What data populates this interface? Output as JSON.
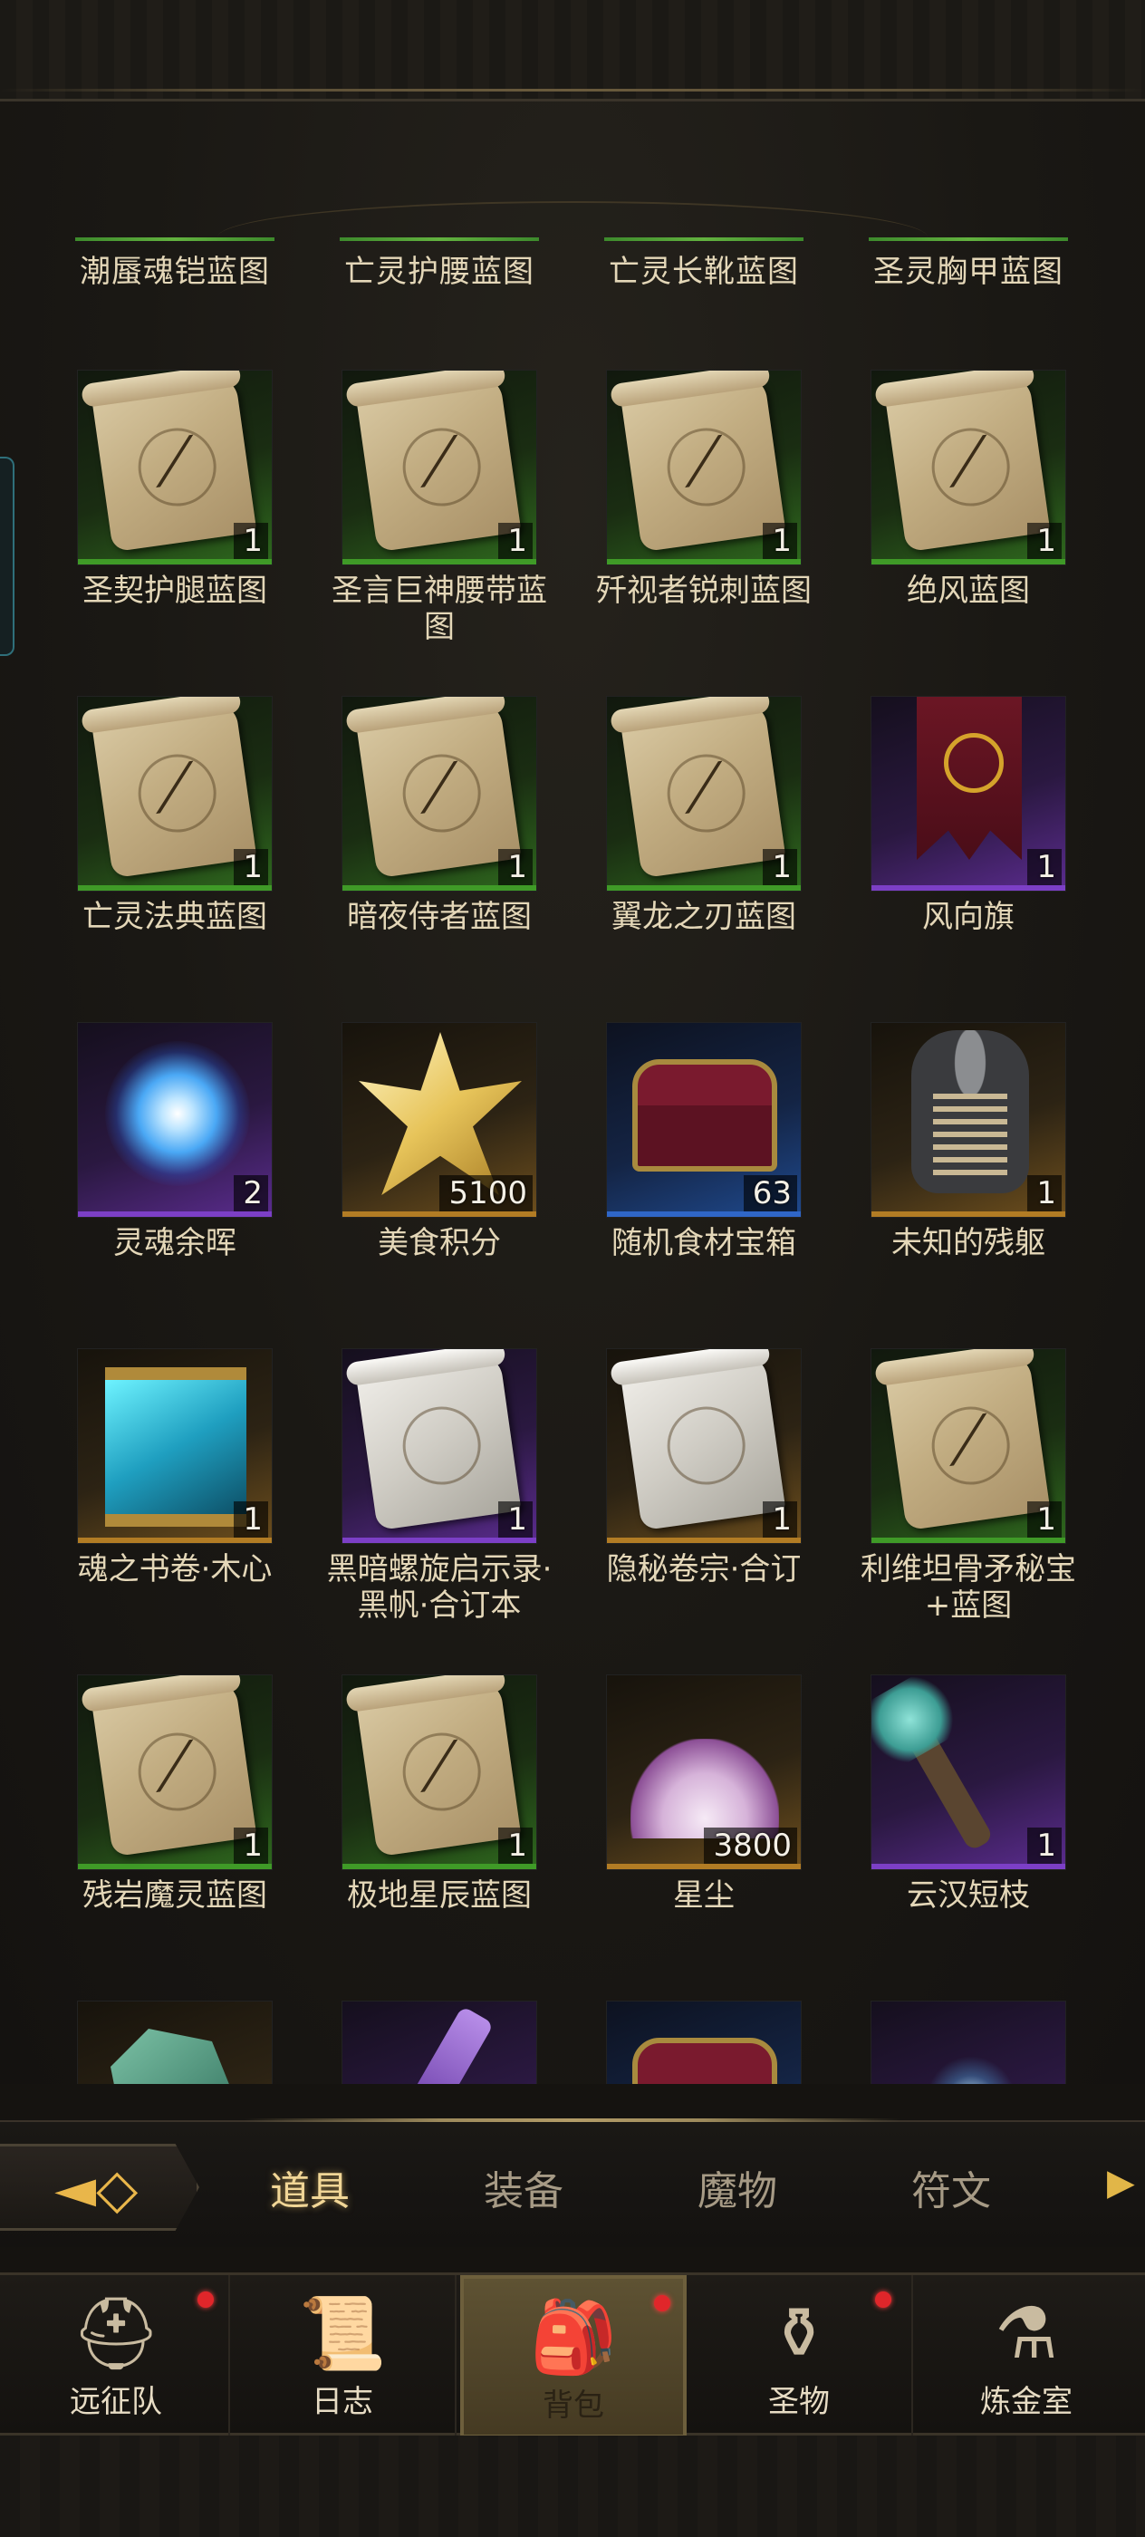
{
  "headers": [
    "潮蜃魂铠蓝图",
    "亡灵护腰蓝图",
    "亡灵长靴蓝图",
    "圣灵胸甲蓝图"
  ],
  "items": [
    {
      "name": "圣契护腿蓝图",
      "count": "1",
      "rarity": "green",
      "icon": "blueprint-scroll-icon"
    },
    {
      "name": "圣言巨神腰带蓝图",
      "count": "1",
      "rarity": "green",
      "icon": "blueprint-scroll-icon"
    },
    {
      "name": "歼视者锐刺蓝图",
      "count": "1",
      "rarity": "green",
      "icon": "blueprint-scroll-icon"
    },
    {
      "name": "绝风蓝图",
      "count": "1",
      "rarity": "green",
      "icon": "blueprint-scroll-icon"
    },
    {
      "name": "亡灵法典蓝图",
      "count": "1",
      "rarity": "green",
      "icon": "blueprint-scroll-icon"
    },
    {
      "name": "暗夜侍者蓝图",
      "count": "1",
      "rarity": "green",
      "icon": "blueprint-scroll-icon"
    },
    {
      "name": "翼龙之刃蓝图",
      "count": "1",
      "rarity": "green",
      "icon": "blueprint-scroll-icon"
    },
    {
      "name": "风向旗",
      "count": "1",
      "rarity": "purple",
      "icon": "banner-icon"
    },
    {
      "name": "灵魂余晖",
      "count": "2",
      "rarity": "purple",
      "icon": "soul-orb-icon"
    },
    {
      "name": "美食积分",
      "count": "5100",
      "rarity": "gold",
      "icon": "star-crystal-icon"
    },
    {
      "name": "随机食材宝箱",
      "count": "63",
      "rarity": "blue",
      "icon": "treasure-chest-icon"
    },
    {
      "name": "未知的残躯",
      "count": "1",
      "rarity": "gold",
      "icon": "skeleton-torso-icon"
    },
    {
      "name": "魂之书卷·木心",
      "count": "1",
      "rarity": "gold",
      "icon": "glowing-scroll-icon"
    },
    {
      "name": "黑暗螺旋启示录·黑帆·合订本",
      "count": "1",
      "rarity": "purple",
      "icon": "white-scroll-icon"
    },
    {
      "name": "隐秘卷宗·合订",
      "count": "1",
      "rarity": "gold",
      "icon": "white-scroll-icon"
    },
    {
      "name": "利维坦骨矛秘宝+蓝图",
      "count": "1",
      "rarity": "green",
      "icon": "blueprint-scroll-icon"
    },
    {
      "name": "残岩魔灵蓝图",
      "count": "1",
      "rarity": "green",
      "icon": "blueprint-scroll-icon"
    },
    {
      "name": "极地星辰蓝图",
      "count": "1",
      "rarity": "green",
      "icon": "blueprint-scroll-icon"
    },
    {
      "name": "星尘",
      "count": "3800",
      "rarity": "gold",
      "icon": "stardust-icon"
    },
    {
      "name": "云汉短枝",
      "count": "1",
      "rarity": "purple",
      "icon": "branch-icon"
    }
  ],
  "partial_items": [
    {
      "rarity": "gold",
      "icon": "crystal-icon"
    },
    {
      "rarity": "purple",
      "icon": "vial-icon"
    },
    {
      "rarity": "blue",
      "icon": "treasure-chest-icon"
    },
    {
      "rarity": "purple",
      "icon": "sparkle-icon"
    }
  ],
  "tabs": [
    "道具",
    "装备",
    "魔物",
    "符文"
  ],
  "active_tab": "道具",
  "nav": [
    {
      "label": "远征队",
      "icon": "viking-helmet-icon",
      "badge": true
    },
    {
      "label": "日志",
      "icon": "journal-icon",
      "badge": false
    },
    {
      "label": "背包",
      "icon": "backpack-icon",
      "badge": true,
      "active": true
    },
    {
      "label": "圣物",
      "icon": "relic-icon",
      "badge": true
    },
    {
      "label": "炼金室",
      "icon": "alchemy-icon",
      "badge": false
    }
  ],
  "colors": {
    "green": "#3f9a27",
    "purple": "#7c3fc6",
    "gold": "#b27c24",
    "blue": "#2f66c7",
    "accent": "#e1b648",
    "badge": "#e0262a"
  }
}
